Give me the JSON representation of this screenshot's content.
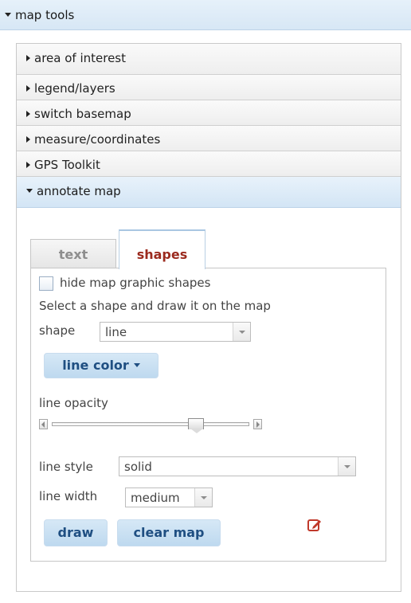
{
  "header": {
    "title": "map tools"
  },
  "accordion": {
    "items": [
      {
        "label": "area of interest"
      },
      {
        "label": "legend/layers"
      },
      {
        "label": "switch basemap"
      },
      {
        "label": "measure/coordinates"
      },
      {
        "label": "GPS Toolkit"
      },
      {
        "label": "annotate map"
      }
    ]
  },
  "tabs": [
    {
      "label": "text",
      "selected": false
    },
    {
      "label": "shapes",
      "selected": true
    }
  ],
  "shapes": {
    "hide_graphics_label": "hide map graphic shapes",
    "hide_graphics_checked": false,
    "instruction": "Select a shape and draw it on the map",
    "shape_label": "shape",
    "shape_value": "line",
    "line_color_button": "line color",
    "opacity_label": "line opacity",
    "opacity_value": 0.75,
    "line_style_label": "line style",
    "line_style_value": "solid",
    "line_width_label": "line width",
    "line_width_value": "medium",
    "draw_button": "draw",
    "clear_button": "clear map"
  },
  "icons": {
    "edit": "pencil-edit-icon",
    "expanded": "triangle-down-icon",
    "collapsed": "triangle-right-icon"
  },
  "colors": {
    "accent": "#1f4f82",
    "selected_tab_text": "#9b2a1e",
    "edit_icon": "#c0392b"
  }
}
